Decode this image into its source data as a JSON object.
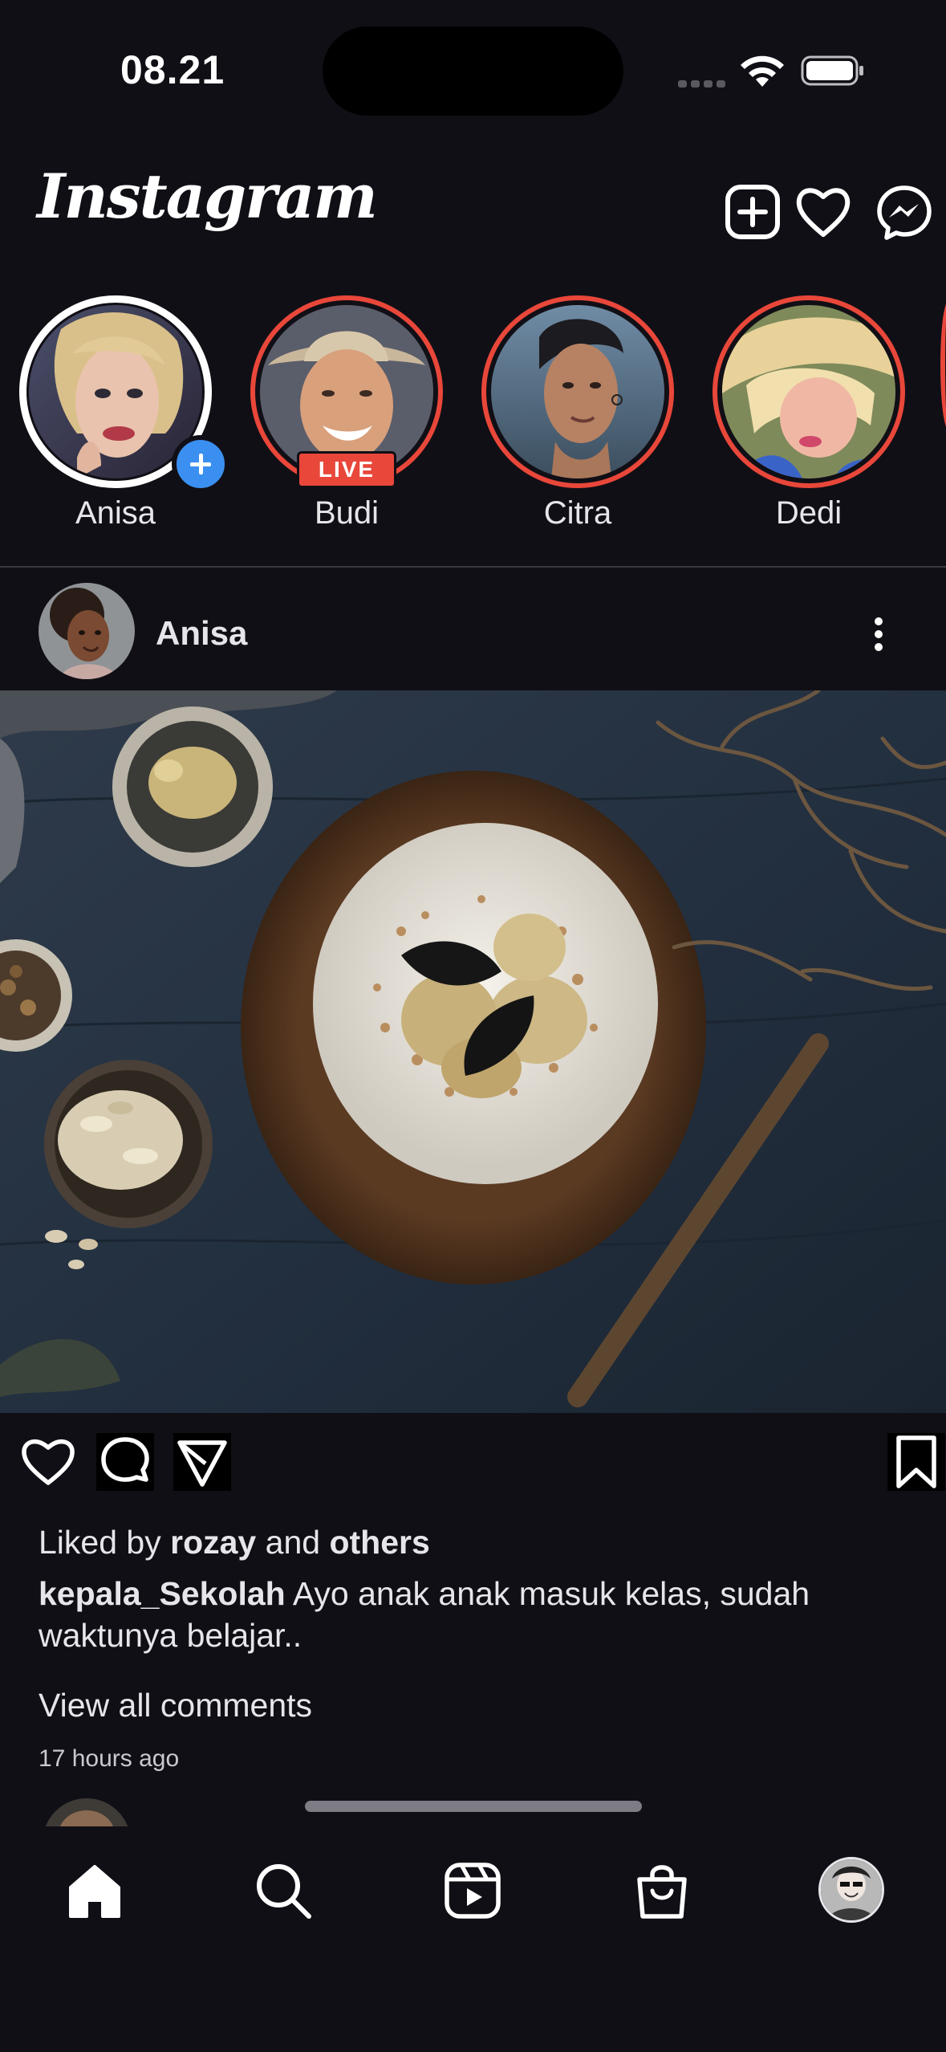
{
  "status_bar": {
    "time": "08.21"
  },
  "header": {
    "logo": "Instagram",
    "icons": [
      "add-post-icon",
      "heart-icon",
      "messenger-icon"
    ]
  },
  "stories": [
    {
      "name": "Anisa",
      "own": true,
      "live": false
    },
    {
      "name": "Budi",
      "own": false,
      "live": true,
      "live_label": "LIVE"
    },
    {
      "name": "Citra",
      "own": false,
      "live": false
    },
    {
      "name": "Dedi",
      "own": false,
      "live": false
    }
  ],
  "post": {
    "username": "Anisa",
    "liked_prefix": "Liked by",
    "liked_user": "rozay",
    "liked_and": "and",
    "liked_others": "others",
    "caption_user": "kepala_Sekolah",
    "caption_text": " Ayo anak anak masuk kelas, sudah waktunya belajar..",
    "view_comments": "View all comments",
    "time_ago": "17 hours ago"
  },
  "colors": {
    "background": "#110f16",
    "story_ring": "#e8473a",
    "add_badge": "#3b8ff0",
    "live_badge": "#e8473a"
  },
  "bottom_nav": [
    "home-icon",
    "search-icon",
    "reels-icon",
    "shop-icon",
    "profile-avatar"
  ]
}
